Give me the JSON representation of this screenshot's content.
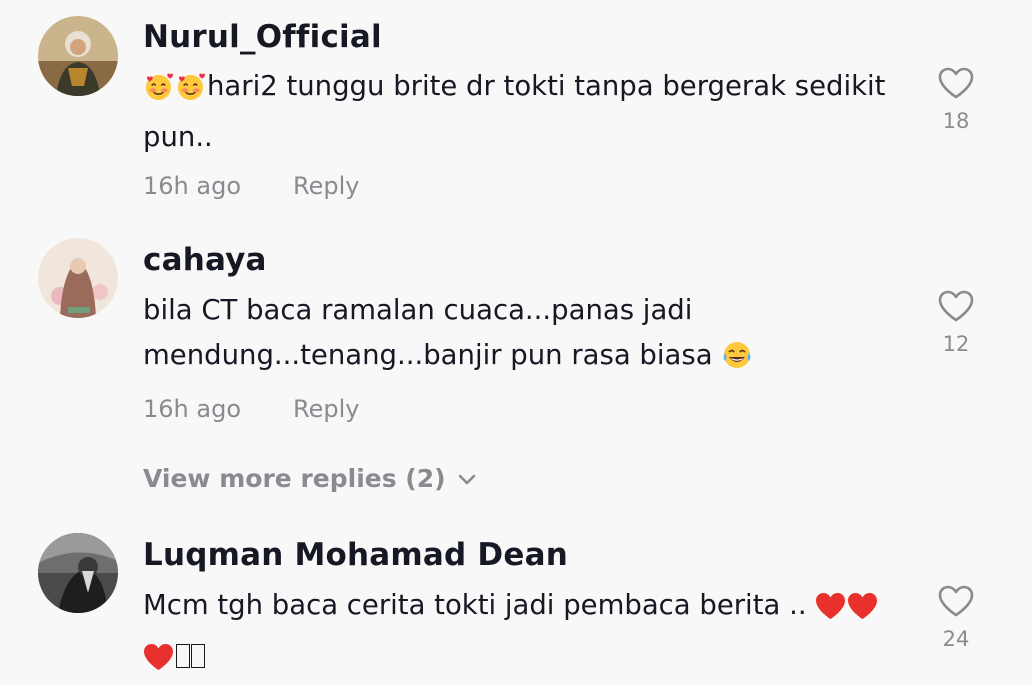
{
  "comments": [
    {
      "username": "Nurul_Official",
      "text": "hari2 tunggu brite dr tokti tanpa bergerak sedikit pun..",
      "leading_emojis": [
        "smiling-face-with-hearts",
        "smiling-face-with-hearts"
      ],
      "time": "16h ago",
      "reply_label": "Reply",
      "likes": "18"
    },
    {
      "username": "cahaya",
      "text": "bila CT baca ramalan cuaca...panas jadi mendung...tenang...banjir pun rasa biasa",
      "trailing_emojis": [
        "face-with-tears-of-joy"
      ],
      "time": "16h ago",
      "reply_label": "Reply",
      "likes": "12"
    },
    {
      "username": "Luqman Mohamad Dean",
      "text": "Mcm tgh baca cerita tokti jadi pembaca berita ..",
      "trailing_emojis": [
        "red-heart",
        "red-heart",
        "red-heart",
        "unrendered-glyph",
        "unrendered-glyph"
      ],
      "likes": "24"
    }
  ],
  "view_more_replies": "View more replies (2)",
  "colors": {
    "primary_text": "#161823",
    "secondary_text": "#8a8b91",
    "background": "#f8f8f8"
  }
}
